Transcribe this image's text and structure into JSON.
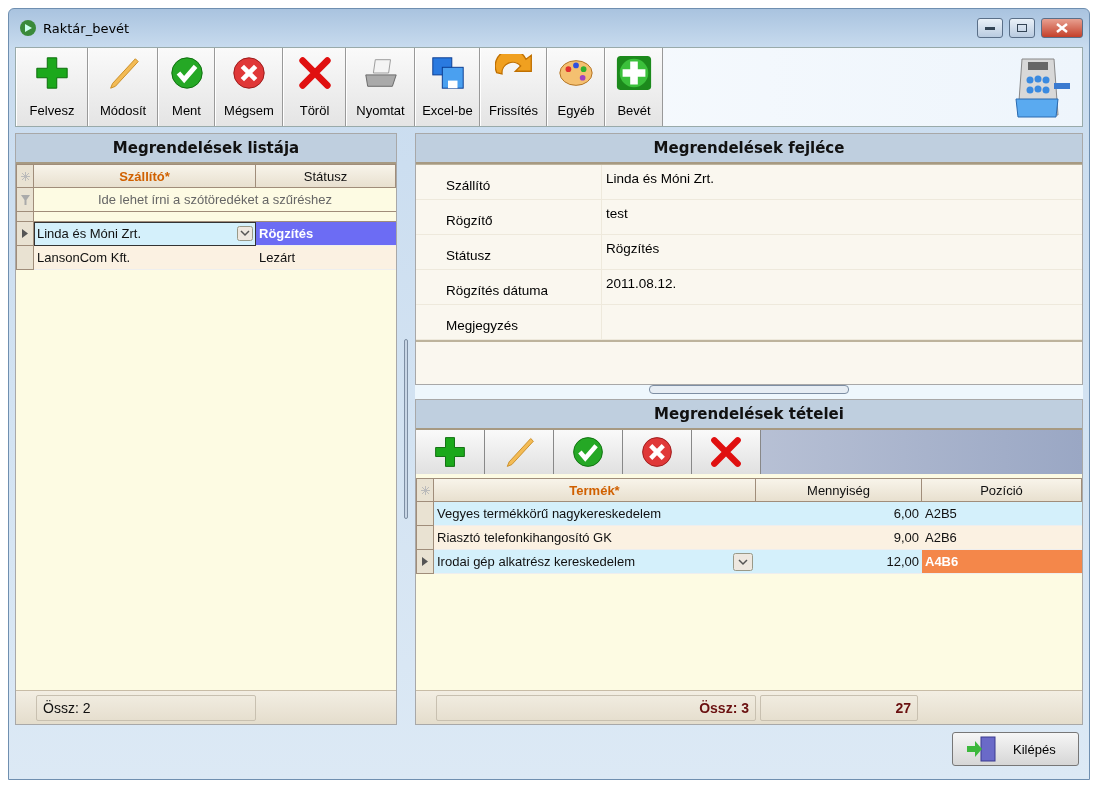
{
  "window": {
    "title": "Raktár_bevét"
  },
  "toolbar": [
    {
      "label": "Felvesz",
      "kind": "add"
    },
    {
      "label": "Módosít",
      "kind": "edit"
    },
    {
      "label": "Ment",
      "kind": "save"
    },
    {
      "label": "Mégsem",
      "kind": "cancel"
    },
    {
      "label": "Töröl",
      "kind": "delete"
    },
    {
      "label": "Nyomtat",
      "kind": "print"
    },
    {
      "label": "Excel-be",
      "kind": "excel"
    },
    {
      "label": "Frissítés",
      "kind": "refresh"
    },
    {
      "label": "Egyéb",
      "kind": "palette"
    },
    {
      "label": "Bevét",
      "kind": "bigadd"
    }
  ],
  "orders": {
    "title": "Megrendelések listája",
    "columns": [
      "Szállító*",
      "Státusz"
    ],
    "filter_placeholder": "Ide lehet írni a szótöredéket a szűréshez",
    "rows": [
      {
        "supplier": "Linda és Móni Zrt.",
        "status": "Rögzítés",
        "selected": true
      },
      {
        "supplier": "LansonCom Kft.",
        "status": "Lezárt",
        "selected": false
      }
    ],
    "footer": "Össz: 2"
  },
  "header": {
    "title": "Megrendelések fejléce",
    "fields": [
      {
        "label": "Szállító",
        "value": "Linda és Móni Zrt."
      },
      {
        "label": "Rögzítő",
        "value": "test"
      },
      {
        "label": "Státusz",
        "value": "Rögzítés"
      },
      {
        "label": "Rögzítés dátuma",
        "value": "2011.08.12."
      },
      {
        "label": "Megjegyzés"
      }
    ]
  },
  "items": {
    "title": "Megrendelések tételei",
    "tools": [
      {
        "kind": "add"
      },
      {
        "kind": "edit"
      },
      {
        "kind": "save"
      },
      {
        "kind": "cancel"
      },
      {
        "kind": "delete"
      }
    ],
    "columns": [
      "Termék*",
      "Mennyiség",
      "Pozíció"
    ],
    "rows": [
      {
        "product": "Vegyes termékkörű nagykereskedelem",
        "quantity": "6,00",
        "position": "A2B5",
        "selected": false
      },
      {
        "product": "Riasztó telefonkihangosító GK",
        "quantity": "9,00",
        "position": "A2B6",
        "selected": false
      },
      {
        "product": "Irodai gép alkatrész kereskedelem",
        "quantity": "12,00",
        "position": "A4B6",
        "selected": true
      }
    ],
    "footer_count": "Össz: 3",
    "footer_total": "27"
  },
  "exit_button": "Kilépés"
}
